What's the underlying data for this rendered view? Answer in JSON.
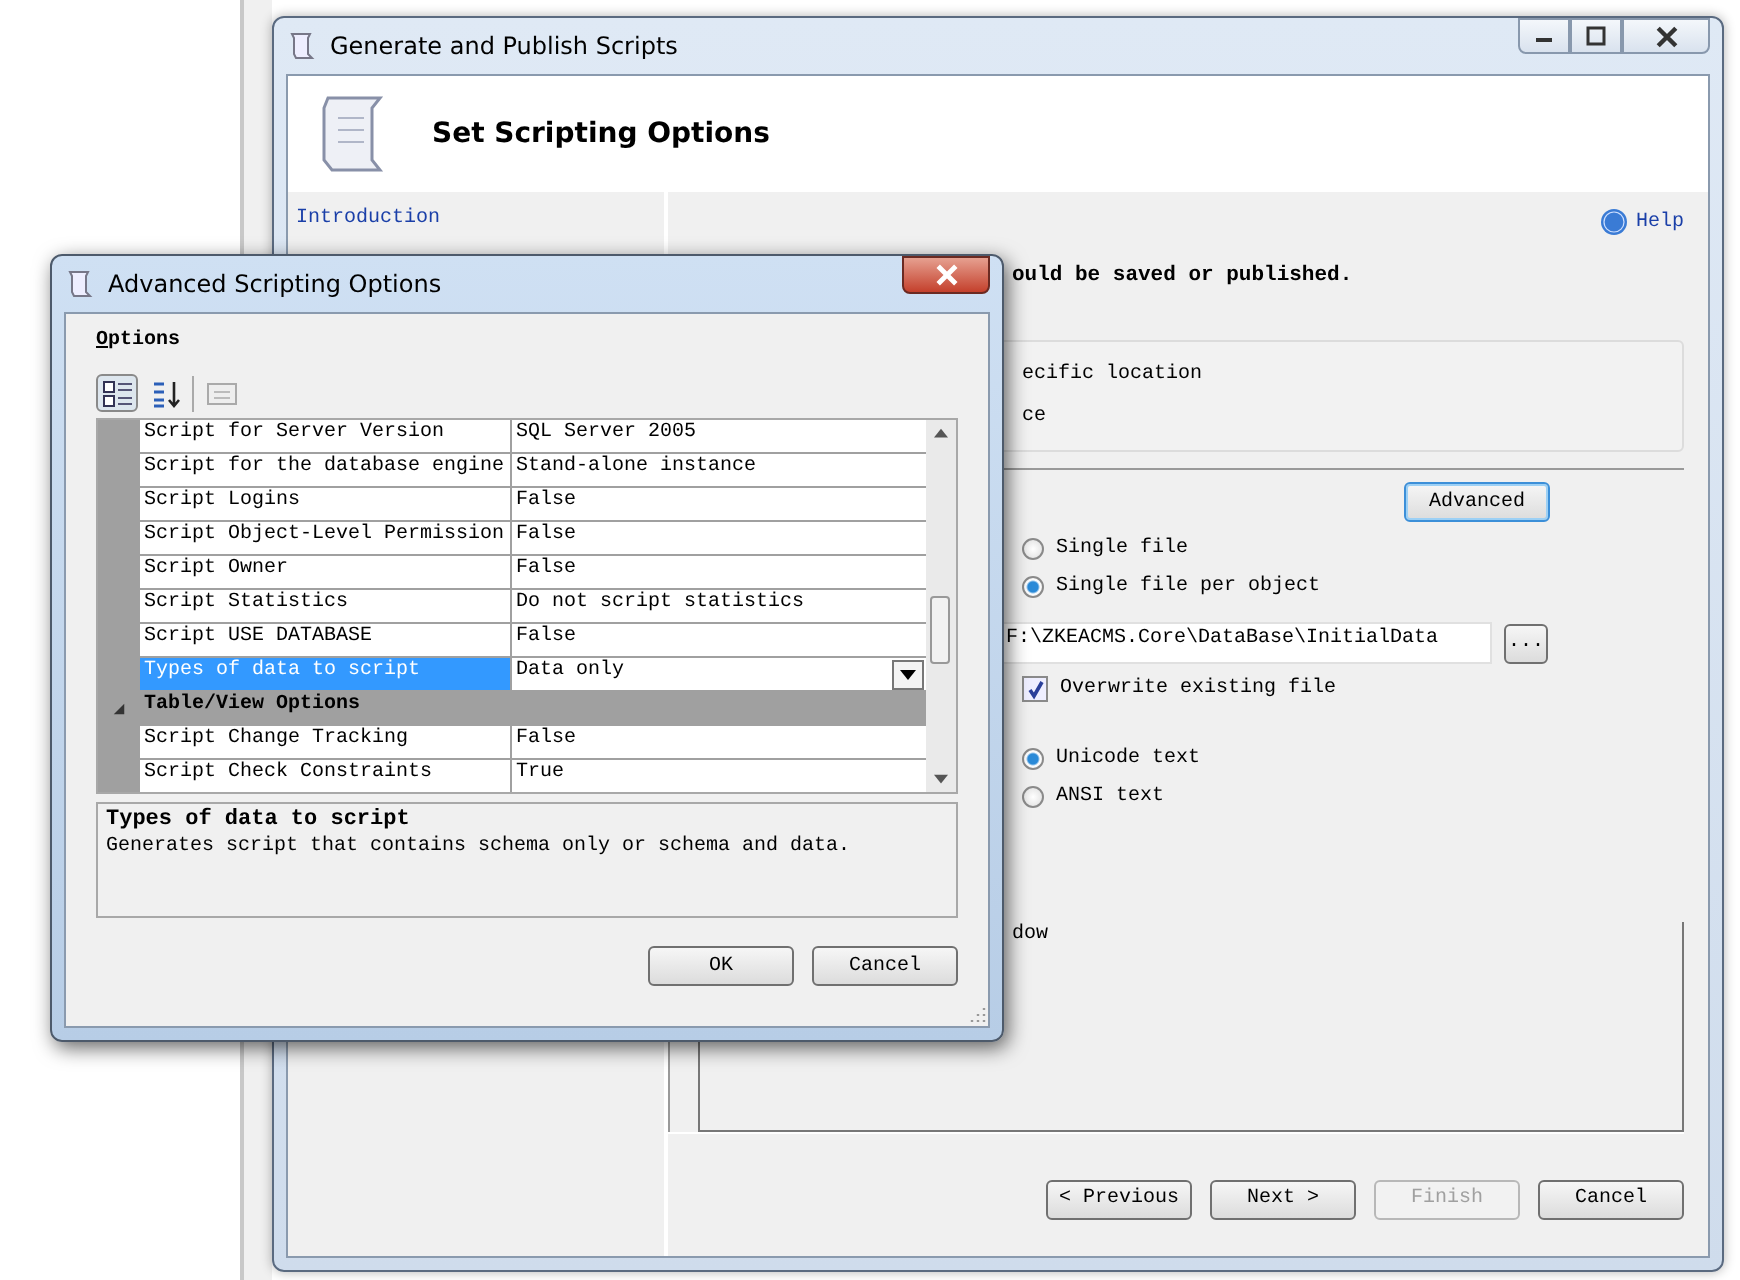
{
  "main_window": {
    "title": "Generate and Publish Scripts",
    "header": "Set Scripting Options",
    "nav": [
      {
        "label": "Introduction"
      }
    ],
    "help": "Help",
    "instruction": "ould be saved or published.",
    "location_options": [
      "ecific location",
      "ce"
    ],
    "advanced_button": "Advanced",
    "file_radios": [
      {
        "label": "Single file",
        "selected": false
      },
      {
        "label": "Single file per object",
        "selected": true
      }
    ],
    "path": "F:\\ZKEACMS.Core\\DataBase\\InitialData",
    "browse_button": "...",
    "overwrite": {
      "label": "Overwrite existing file",
      "checked": true
    },
    "encoding_radios": [
      {
        "label": "Unicode text",
        "selected": true
      },
      {
        "label": "ANSI text",
        "selected": false
      }
    ],
    "cut_label": "dow",
    "buttons": [
      {
        "label": "< Previous",
        "disabled": false
      },
      {
        "label": "Next >",
        "disabled": false
      },
      {
        "label": "Finish",
        "disabled": true
      },
      {
        "label": "Cancel",
        "disabled": false
      }
    ]
  },
  "dialog": {
    "title": "Advanced Scripting Options",
    "options_label": "Options",
    "rows": [
      {
        "kind": "property",
        "name": "Script for Server Version",
        "value": "SQL Server 2005",
        "selected": false
      },
      {
        "kind": "property",
        "name": "Script for the database engine",
        "value": "Stand-alone instance",
        "selected": false
      },
      {
        "kind": "property",
        "name": "Script Logins",
        "value": "False",
        "selected": false
      },
      {
        "kind": "property",
        "name": "Script Object-Level Permission",
        "value": "False",
        "selected": false
      },
      {
        "kind": "property",
        "name": "Script Owner",
        "value": "False",
        "selected": false
      },
      {
        "kind": "property",
        "name": "Script Statistics",
        "value": "Do not script statistics",
        "selected": false
      },
      {
        "kind": "property",
        "name": "Script USE DATABASE",
        "value": "False",
        "selected": false
      },
      {
        "kind": "property",
        "name": "Types of data to script",
        "value": "Data only",
        "selected": true
      },
      {
        "kind": "category",
        "name": "Table/View Options",
        "expanded": true
      },
      {
        "kind": "property",
        "name": "Script Change Tracking",
        "value": "False",
        "selected": false
      },
      {
        "kind": "property",
        "name": "Script Check Constraints",
        "value": "True",
        "selected": false
      }
    ],
    "description": {
      "title": "Types of data to script",
      "text": "Generates script that contains schema only or schema and data."
    },
    "buttons": [
      "OK",
      "Cancel"
    ]
  }
}
